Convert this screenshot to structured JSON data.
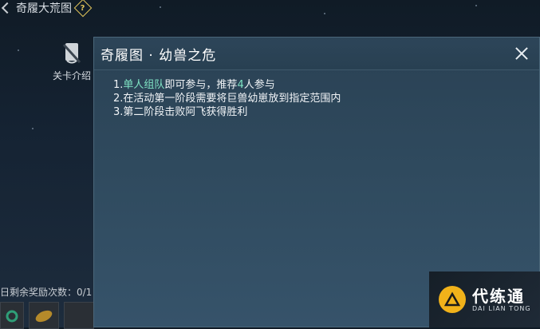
{
  "background": {
    "title": "奇履大荒图",
    "help_glyph": "?",
    "stage_intro_label": "关卡介绍",
    "remaining_text": "日剩余奖励次数：0/1"
  },
  "modal": {
    "title": "奇履图 · 幼兽之危",
    "close_icon": "close-icon",
    "rules": {
      "r1_prefix": "1.",
      "r1_hl1": "单人组队",
      "r1_mid": "即可参与，推荐",
      "r1_hl2": "4",
      "r1_suffix": "人参与",
      "r2": "2.在活动第一阶段需要将巨兽幼崽放到指定范围内",
      "r3": "3.第二阶段击败阿飞获得胜利"
    },
    "highlight_color": "#7fe3c4"
  },
  "watermark": {
    "cn": "代练通",
    "en": "DAI LIAN TONG"
  }
}
